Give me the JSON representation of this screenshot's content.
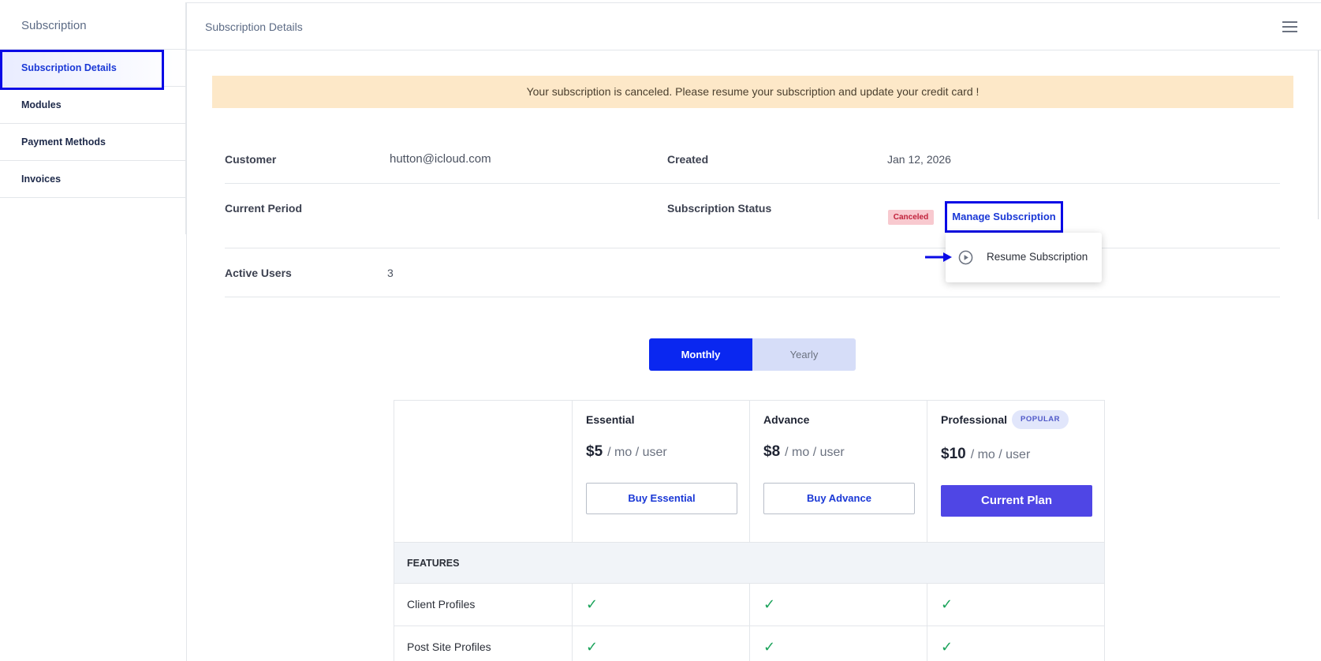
{
  "sidebar": {
    "title": "Subscription",
    "items": [
      {
        "label": "Subscription Details"
      },
      {
        "label": "Modules"
      },
      {
        "label": "Payment Methods"
      },
      {
        "label": "Invoices"
      }
    ]
  },
  "header": {
    "title": "Subscription Details",
    "menu_icon": "hamburger-icon"
  },
  "alert": {
    "message": "Your subscription is canceled. Please resume your subscription and update your credit card !"
  },
  "details": {
    "customer_label": "Customer",
    "customer_value": "hutton@icloud.com",
    "created_label": "Created",
    "created_value": "Jan 12, 2026",
    "period_label": "Current Period",
    "status_label": "Subscription Status",
    "status_badge": "Canceled",
    "manage_label": "Manage Subscription",
    "users_label": "Active Users",
    "users_value": "3"
  },
  "dropdown": {
    "resume_label": "Resume Subscription",
    "icon": "play-circle-icon"
  },
  "billing_toggle": {
    "monthly": "Monthly",
    "yearly": "Yearly",
    "selected": "Monthly"
  },
  "plans": [
    {
      "name": "Essential",
      "price": "$5",
      "unit": "/ mo / user",
      "button": "Buy Essential"
    },
    {
      "name": "Advance",
      "price": "$8",
      "unit": "/ mo / user",
      "button": "Buy Advance"
    },
    {
      "name": "Professional",
      "price": "$10",
      "unit": "/ mo / user",
      "button": "Current Plan",
      "badge": "POPULAR"
    }
  ],
  "features": {
    "header": "FEATURES",
    "rows": [
      {
        "label": "Client Profiles",
        "values": [
          true,
          true,
          true
        ]
      },
      {
        "label": "Post Site Profiles",
        "values": [
          true,
          true,
          true
        ]
      }
    ],
    "check_glyph": "✓"
  },
  "colors": {
    "accent": "#0a27f0",
    "highlight_outline": "#0a0ae6",
    "alert_bg": "#fde8c8",
    "current_plan": "#4f46e5",
    "check": "#1aa35a",
    "canceled_badge": "#f8c9cf"
  }
}
